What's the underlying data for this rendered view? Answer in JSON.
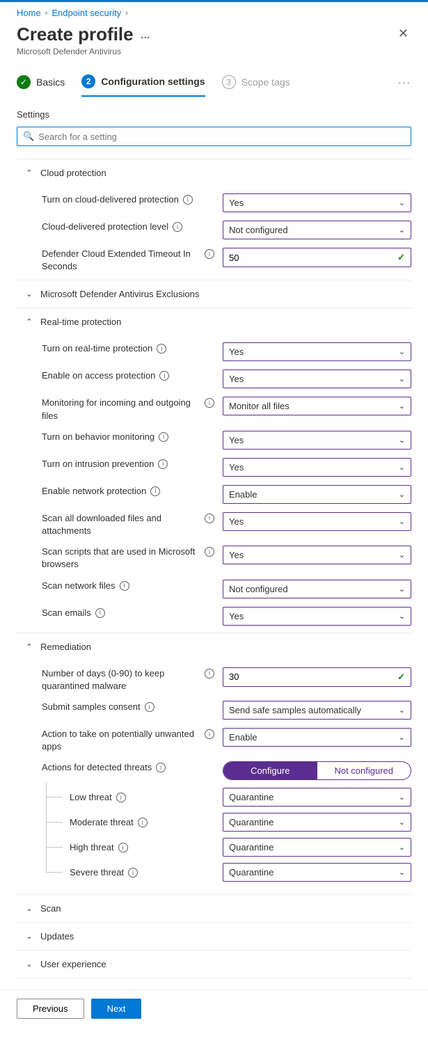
{
  "breadcrumb": {
    "home": "Home",
    "l2": "Endpoint security"
  },
  "header": {
    "title": "Create profile",
    "subtitle": "Microsoft Defender Antivirus"
  },
  "wizard": {
    "s1": "Basics",
    "s2n": "2",
    "s2": "Configuration settings",
    "s3n": "3",
    "s3": "Scope tags"
  },
  "settings_title": "Settings",
  "search_placeholder": "Search for a setting",
  "groups": {
    "cloud": {
      "title": "Cloud protection",
      "r1": {
        "label": "Turn on cloud-delivered protection",
        "value": "Yes"
      },
      "r2": {
        "label": "Cloud-delivered protection level",
        "value": "Not configured"
      },
      "r3": {
        "label": "Defender Cloud Extended Timeout In Seconds",
        "value": "50"
      }
    },
    "exclusions": {
      "title": "Microsoft Defender Antivirus Exclusions"
    },
    "realtime": {
      "title": "Real-time protection",
      "r1": {
        "label": "Turn on real-time protection",
        "value": "Yes"
      },
      "r2": {
        "label": "Enable on access protection",
        "value": "Yes"
      },
      "r3": {
        "label": "Monitoring for incoming and outgoing files",
        "value": "Monitor all files"
      },
      "r4": {
        "label": "Turn on behavior monitoring",
        "value": "Yes"
      },
      "r5": {
        "label": "Turn on intrusion prevention",
        "value": "Yes"
      },
      "r6": {
        "label": "Enable network protection",
        "value": "Enable"
      },
      "r7": {
        "label": "Scan all downloaded files and attachments",
        "value": "Yes"
      },
      "r8": {
        "label": "Scan scripts that are used in Microsoft browsers",
        "value": "Yes"
      },
      "r9": {
        "label": "Scan network files",
        "value": "Not configured"
      },
      "r10": {
        "label": "Scan emails",
        "value": "Yes"
      }
    },
    "remediation": {
      "title": "Remediation",
      "r1": {
        "label": "Number of days (0-90) to keep quarantined malware",
        "value": "30"
      },
      "r2": {
        "label": "Submit samples consent",
        "value": "Send safe samples automatically"
      },
      "r3": {
        "label": "Action to take on potentially unwanted apps",
        "value": "Enable"
      },
      "r4": {
        "label": "Actions for detected threats",
        "opt1": "Configure",
        "opt2": "Not configured"
      },
      "t1": {
        "label": "Low threat",
        "value": "Quarantine"
      },
      "t2": {
        "label": "Moderate threat",
        "value": "Quarantine"
      },
      "t3": {
        "label": "High threat",
        "value": "Quarantine"
      },
      "t4": {
        "label": "Severe threat",
        "value": "Quarantine"
      }
    },
    "scan": {
      "title": "Scan"
    },
    "updates": {
      "title": "Updates"
    },
    "ux": {
      "title": "User experience"
    }
  },
  "footer": {
    "prev": "Previous",
    "next": "Next"
  }
}
